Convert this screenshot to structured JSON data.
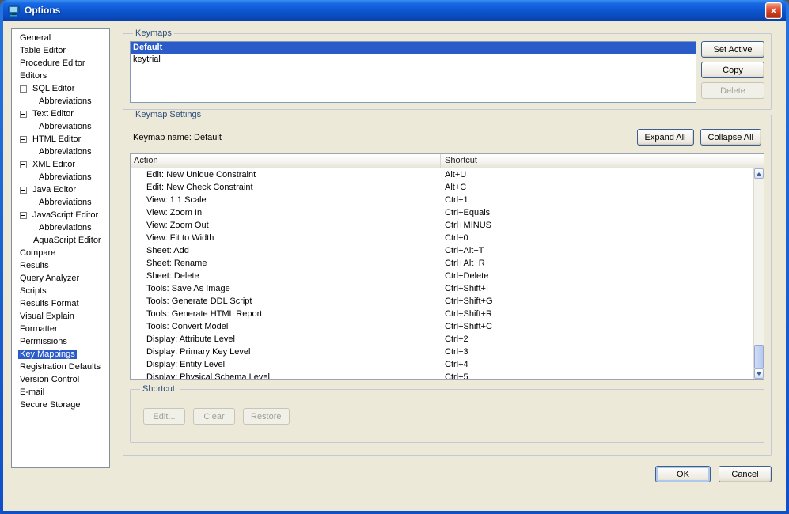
{
  "window": {
    "title": "Options",
    "close_glyph": "×"
  },
  "colors": {
    "selection": "#2B5BC9",
    "titlebar_blue": "#0D55CE",
    "dialog_background": "#ECE9D8",
    "group_title": "#2B4C7E"
  },
  "sidebar": {
    "items": [
      {
        "label": "General",
        "indent": 0
      },
      {
        "label": "Table Editor",
        "indent": 0
      },
      {
        "label": "Procedure Editor",
        "indent": 0
      },
      {
        "label": "Editors",
        "indent": 0
      },
      {
        "label": "SQL Editor",
        "indent": 1,
        "collapse": true
      },
      {
        "label": "Abbreviations",
        "indent": 2
      },
      {
        "label": "Text Editor",
        "indent": 1,
        "collapse": true
      },
      {
        "label": "Abbreviations",
        "indent": 2
      },
      {
        "label": "HTML Editor",
        "indent": 1,
        "collapse": true
      },
      {
        "label": "Abbreviations",
        "indent": 2
      },
      {
        "label": "XML Editor",
        "indent": 1,
        "collapse": true
      },
      {
        "label": "Abbreviations",
        "indent": 2
      },
      {
        "label": "Java Editor",
        "indent": 1,
        "collapse": true
      },
      {
        "label": "Abbreviations",
        "indent": 2
      },
      {
        "label": "JavaScript Editor",
        "indent": 1,
        "collapse": true
      },
      {
        "label": "Abbreviations",
        "indent": 2
      },
      {
        "label": "AquaScript Editor",
        "indent": 1
      },
      {
        "label": "Compare",
        "indent": 0
      },
      {
        "label": "Results",
        "indent": 0
      },
      {
        "label": "Query Analyzer",
        "indent": 0
      },
      {
        "label": "Scripts",
        "indent": 0
      },
      {
        "label": "Results Format",
        "indent": 0
      },
      {
        "label": "Visual Explain",
        "indent": 0
      },
      {
        "label": "Formatter",
        "indent": 0
      },
      {
        "label": "Permissions",
        "indent": 0
      },
      {
        "label": "Key Mappings",
        "indent": 0,
        "selected": true
      },
      {
        "label": "Registration Defaults",
        "indent": 0
      },
      {
        "label": "Version Control",
        "indent": 0
      },
      {
        "label": "E-mail",
        "indent": 0
      },
      {
        "label": "Secure Storage",
        "indent": 0
      }
    ]
  },
  "keymaps": {
    "group_title": "Keymaps",
    "list": [
      {
        "name": "Default",
        "selected": true
      },
      {
        "name": "keytrial",
        "selected": false
      }
    ],
    "buttons": {
      "set_active": "Set Active",
      "copy": "Copy",
      "delete": "Delete"
    }
  },
  "keymap_settings": {
    "group_title": "Keymap Settings",
    "keymap_name_label": "Keymap name: Default",
    "expand_all": "Expand All",
    "collapse_all": "Collapse All",
    "table": {
      "columns": [
        "Action",
        "Shortcut"
      ],
      "rows": [
        {
          "action": "Edit: New Unique Constraint",
          "shortcut": "Alt+U"
        },
        {
          "action": "Edit: New Check Constraint",
          "shortcut": "Alt+C"
        },
        {
          "action": "View: 1:1 Scale",
          "shortcut": "Ctrl+1"
        },
        {
          "action": "View: Zoom In",
          "shortcut": "Ctrl+Equals"
        },
        {
          "action": "View: Zoom Out",
          "shortcut": "Ctrl+MINUS"
        },
        {
          "action": "View: Fit to Width",
          "shortcut": "Ctrl+0"
        },
        {
          "action": "Sheet: Add",
          "shortcut": "Ctrl+Alt+T"
        },
        {
          "action": "Sheet: Rename",
          "shortcut": "Ctrl+Alt+R"
        },
        {
          "action": "Sheet: Delete",
          "shortcut": "Ctrl+Delete"
        },
        {
          "action": "Tools: Save As Image",
          "shortcut": "Ctrl+Shift+I"
        },
        {
          "action": "Tools: Generate DDL Script",
          "shortcut": "Ctrl+Shift+G"
        },
        {
          "action": "Tools: Generate HTML Report",
          "shortcut": "Ctrl+Shift+R"
        },
        {
          "action": "Tools: Convert Model",
          "shortcut": "Ctrl+Shift+C"
        },
        {
          "action": "Display: Attribute Level",
          "shortcut": "Ctrl+2"
        },
        {
          "action": "Display: Primary Key Level",
          "shortcut": "Ctrl+3"
        },
        {
          "action": "Display: Entity Level",
          "shortcut": "Ctrl+4"
        },
        {
          "action": "Display: Physical Schema Level",
          "shortcut": "Ctrl+5"
        }
      ]
    },
    "shortcut_group": {
      "title": "Shortcut:",
      "buttons": {
        "edit": "Edit...",
        "clear": "Clear",
        "restore": "Restore"
      }
    }
  },
  "footer": {
    "ok": "OK",
    "cancel": "Cancel"
  }
}
